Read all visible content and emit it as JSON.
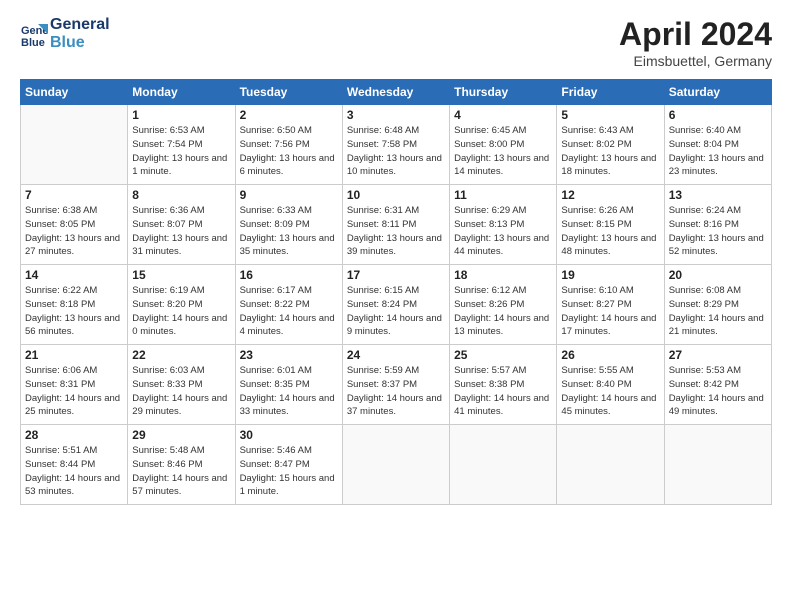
{
  "header": {
    "logo_line1": "General",
    "logo_line2": "Blue",
    "title": "April 2024",
    "location": "Eimsbuettel, Germany"
  },
  "days_of_week": [
    "Sunday",
    "Monday",
    "Tuesday",
    "Wednesday",
    "Thursday",
    "Friday",
    "Saturday"
  ],
  "weeks": [
    [
      {
        "num": "",
        "sunrise": "",
        "sunset": "",
        "daylight": ""
      },
      {
        "num": "1",
        "sunrise": "Sunrise: 6:53 AM",
        "sunset": "Sunset: 7:54 PM",
        "daylight": "Daylight: 13 hours and 1 minute."
      },
      {
        "num": "2",
        "sunrise": "Sunrise: 6:50 AM",
        "sunset": "Sunset: 7:56 PM",
        "daylight": "Daylight: 13 hours and 6 minutes."
      },
      {
        "num": "3",
        "sunrise": "Sunrise: 6:48 AM",
        "sunset": "Sunset: 7:58 PM",
        "daylight": "Daylight: 13 hours and 10 minutes."
      },
      {
        "num": "4",
        "sunrise": "Sunrise: 6:45 AM",
        "sunset": "Sunset: 8:00 PM",
        "daylight": "Daylight: 13 hours and 14 minutes."
      },
      {
        "num": "5",
        "sunrise": "Sunrise: 6:43 AM",
        "sunset": "Sunset: 8:02 PM",
        "daylight": "Daylight: 13 hours and 18 minutes."
      },
      {
        "num": "6",
        "sunrise": "Sunrise: 6:40 AM",
        "sunset": "Sunset: 8:04 PM",
        "daylight": "Daylight: 13 hours and 23 minutes."
      }
    ],
    [
      {
        "num": "7",
        "sunrise": "Sunrise: 6:38 AM",
        "sunset": "Sunset: 8:05 PM",
        "daylight": "Daylight: 13 hours and 27 minutes."
      },
      {
        "num": "8",
        "sunrise": "Sunrise: 6:36 AM",
        "sunset": "Sunset: 8:07 PM",
        "daylight": "Daylight: 13 hours and 31 minutes."
      },
      {
        "num": "9",
        "sunrise": "Sunrise: 6:33 AM",
        "sunset": "Sunset: 8:09 PM",
        "daylight": "Daylight: 13 hours and 35 minutes."
      },
      {
        "num": "10",
        "sunrise": "Sunrise: 6:31 AM",
        "sunset": "Sunset: 8:11 PM",
        "daylight": "Daylight: 13 hours and 39 minutes."
      },
      {
        "num": "11",
        "sunrise": "Sunrise: 6:29 AM",
        "sunset": "Sunset: 8:13 PM",
        "daylight": "Daylight: 13 hours and 44 minutes."
      },
      {
        "num": "12",
        "sunrise": "Sunrise: 6:26 AM",
        "sunset": "Sunset: 8:15 PM",
        "daylight": "Daylight: 13 hours and 48 minutes."
      },
      {
        "num": "13",
        "sunrise": "Sunrise: 6:24 AM",
        "sunset": "Sunset: 8:16 PM",
        "daylight": "Daylight: 13 hours and 52 minutes."
      }
    ],
    [
      {
        "num": "14",
        "sunrise": "Sunrise: 6:22 AM",
        "sunset": "Sunset: 8:18 PM",
        "daylight": "Daylight: 13 hours and 56 minutes."
      },
      {
        "num": "15",
        "sunrise": "Sunrise: 6:19 AM",
        "sunset": "Sunset: 8:20 PM",
        "daylight": "Daylight: 14 hours and 0 minutes."
      },
      {
        "num": "16",
        "sunrise": "Sunrise: 6:17 AM",
        "sunset": "Sunset: 8:22 PM",
        "daylight": "Daylight: 14 hours and 4 minutes."
      },
      {
        "num": "17",
        "sunrise": "Sunrise: 6:15 AM",
        "sunset": "Sunset: 8:24 PM",
        "daylight": "Daylight: 14 hours and 9 minutes."
      },
      {
        "num": "18",
        "sunrise": "Sunrise: 6:12 AM",
        "sunset": "Sunset: 8:26 PM",
        "daylight": "Daylight: 14 hours and 13 minutes."
      },
      {
        "num": "19",
        "sunrise": "Sunrise: 6:10 AM",
        "sunset": "Sunset: 8:27 PM",
        "daylight": "Daylight: 14 hours and 17 minutes."
      },
      {
        "num": "20",
        "sunrise": "Sunrise: 6:08 AM",
        "sunset": "Sunset: 8:29 PM",
        "daylight": "Daylight: 14 hours and 21 minutes."
      }
    ],
    [
      {
        "num": "21",
        "sunrise": "Sunrise: 6:06 AM",
        "sunset": "Sunset: 8:31 PM",
        "daylight": "Daylight: 14 hours and 25 minutes."
      },
      {
        "num": "22",
        "sunrise": "Sunrise: 6:03 AM",
        "sunset": "Sunset: 8:33 PM",
        "daylight": "Daylight: 14 hours and 29 minutes."
      },
      {
        "num": "23",
        "sunrise": "Sunrise: 6:01 AM",
        "sunset": "Sunset: 8:35 PM",
        "daylight": "Daylight: 14 hours and 33 minutes."
      },
      {
        "num": "24",
        "sunrise": "Sunrise: 5:59 AM",
        "sunset": "Sunset: 8:37 PM",
        "daylight": "Daylight: 14 hours and 37 minutes."
      },
      {
        "num": "25",
        "sunrise": "Sunrise: 5:57 AM",
        "sunset": "Sunset: 8:38 PM",
        "daylight": "Daylight: 14 hours and 41 minutes."
      },
      {
        "num": "26",
        "sunrise": "Sunrise: 5:55 AM",
        "sunset": "Sunset: 8:40 PM",
        "daylight": "Daylight: 14 hours and 45 minutes."
      },
      {
        "num": "27",
        "sunrise": "Sunrise: 5:53 AM",
        "sunset": "Sunset: 8:42 PM",
        "daylight": "Daylight: 14 hours and 49 minutes."
      }
    ],
    [
      {
        "num": "28",
        "sunrise": "Sunrise: 5:51 AM",
        "sunset": "Sunset: 8:44 PM",
        "daylight": "Daylight: 14 hours and 53 minutes."
      },
      {
        "num": "29",
        "sunrise": "Sunrise: 5:48 AM",
        "sunset": "Sunset: 8:46 PM",
        "daylight": "Daylight: 14 hours and 57 minutes."
      },
      {
        "num": "30",
        "sunrise": "Sunrise: 5:46 AM",
        "sunset": "Sunset: 8:47 PM",
        "daylight": "Daylight: 15 hours and 1 minute."
      },
      {
        "num": "",
        "sunrise": "",
        "sunset": "",
        "daylight": ""
      },
      {
        "num": "",
        "sunrise": "",
        "sunset": "",
        "daylight": ""
      },
      {
        "num": "",
        "sunrise": "",
        "sunset": "",
        "daylight": ""
      },
      {
        "num": "",
        "sunrise": "",
        "sunset": "",
        "daylight": ""
      }
    ]
  ]
}
